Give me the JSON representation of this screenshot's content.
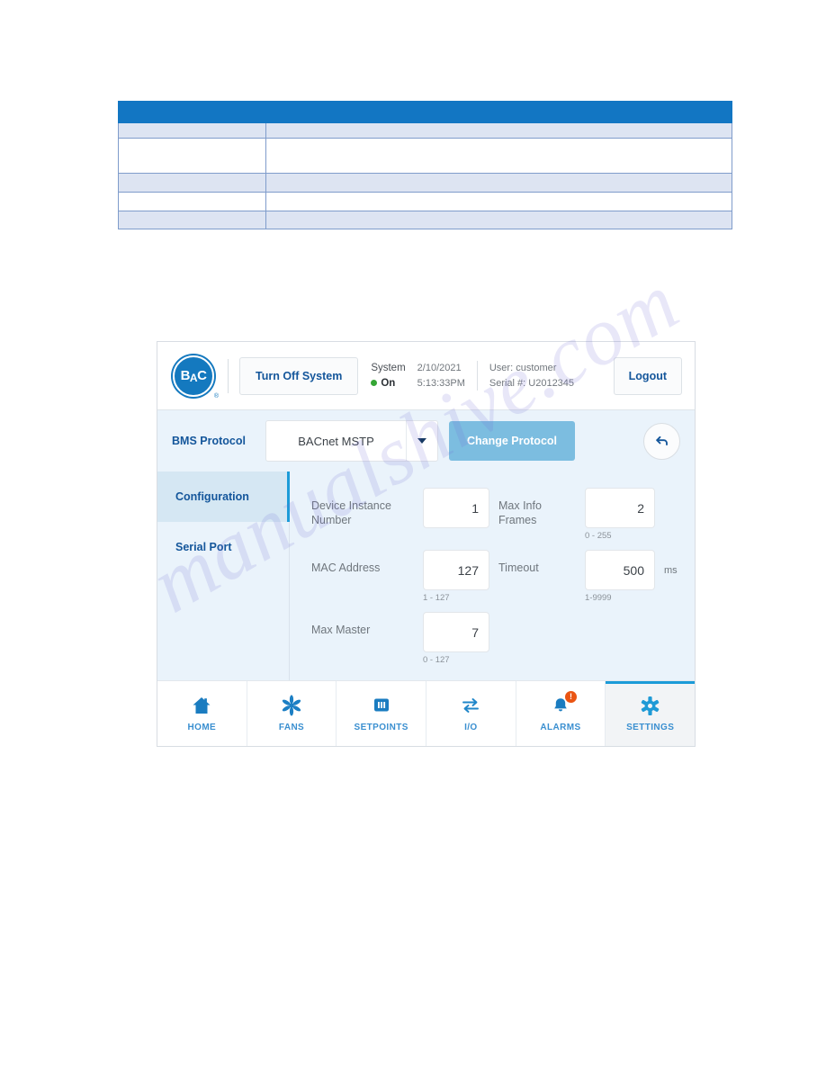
{
  "document_table": {
    "column_widths": [
      "164px",
      "auto"
    ],
    "rows": [
      {
        "style": "header",
        "cells": [
          "",
          ""
        ]
      },
      {
        "style": "tint",
        "cells": [
          "",
          ""
        ]
      },
      {
        "style": "plain",
        "cells": [
          "",
          ""
        ]
      },
      {
        "style": "tint",
        "cells": [
          "",
          ""
        ]
      },
      {
        "style": "plain",
        "cells": [
          "",
          ""
        ]
      },
      {
        "style": "tint",
        "cells": [
          "",
          ""
        ]
      }
    ],
    "header_color": "#1276c3",
    "tint_color": "#dde4f2",
    "border_color": "#7f9ccb"
  },
  "hmi": {
    "header": {
      "logo": {
        "text_b": "B",
        "text_a": "A",
        "text_c": "C",
        "registered": "®"
      },
      "turn_off_label": "Turn Off System",
      "system_label": "System",
      "system_state": "On",
      "system_state_color": "#35a635",
      "date": "2/10/2021",
      "time": "5:13:33PM",
      "user": "User: customer",
      "serial": "Serial #: U2012345",
      "logout_label": "Logout"
    },
    "protocol_row": {
      "label": "BMS Protocol",
      "selected_value": "BACnet MSTP",
      "change_button_label": "Change Protocol",
      "change_button_color": "#7cbde0",
      "undo_icon": "undo-arrow-icon"
    },
    "side_tabs": [
      {
        "label": "Configuration",
        "active": true
      },
      {
        "label": "Serial Port",
        "active": false
      }
    ],
    "fields": {
      "device_instance_number": {
        "label": "Device Instance Number",
        "value": "1",
        "hint": "",
        "unit": ""
      },
      "max_info_frames": {
        "label": "Max Info Frames",
        "value": "2",
        "hint": "0 - 255",
        "unit": ""
      },
      "mac_address": {
        "label": "MAC Address",
        "value": "127",
        "hint": "1 - 127",
        "unit": ""
      },
      "timeout": {
        "label": "Timeout",
        "value": "500",
        "hint": "1-9999",
        "unit": "ms"
      },
      "max_master": {
        "label": "Max Master",
        "value": "7",
        "hint": "0 - 127",
        "unit": ""
      }
    },
    "nav": [
      {
        "label": "HOME",
        "icon": "home-icon",
        "active": false,
        "badge": ""
      },
      {
        "label": "FANS",
        "icon": "fan-icon",
        "active": false,
        "badge": ""
      },
      {
        "label": "SETPOINTS",
        "icon": "setpoints-icon",
        "active": false,
        "badge": ""
      },
      {
        "label": "I/O",
        "icon": "io-arrows-icon",
        "active": false,
        "badge": ""
      },
      {
        "label": "ALARMS",
        "icon": "alarm-bell-icon",
        "active": false,
        "badge": "!"
      },
      {
        "label": "SETTINGS",
        "icon": "gear-icon",
        "active": true,
        "badge": ""
      }
    ],
    "accent_color": "#1c9bd8",
    "link_color": "#14569b"
  },
  "watermark": {
    "text": "manualshive.com"
  }
}
